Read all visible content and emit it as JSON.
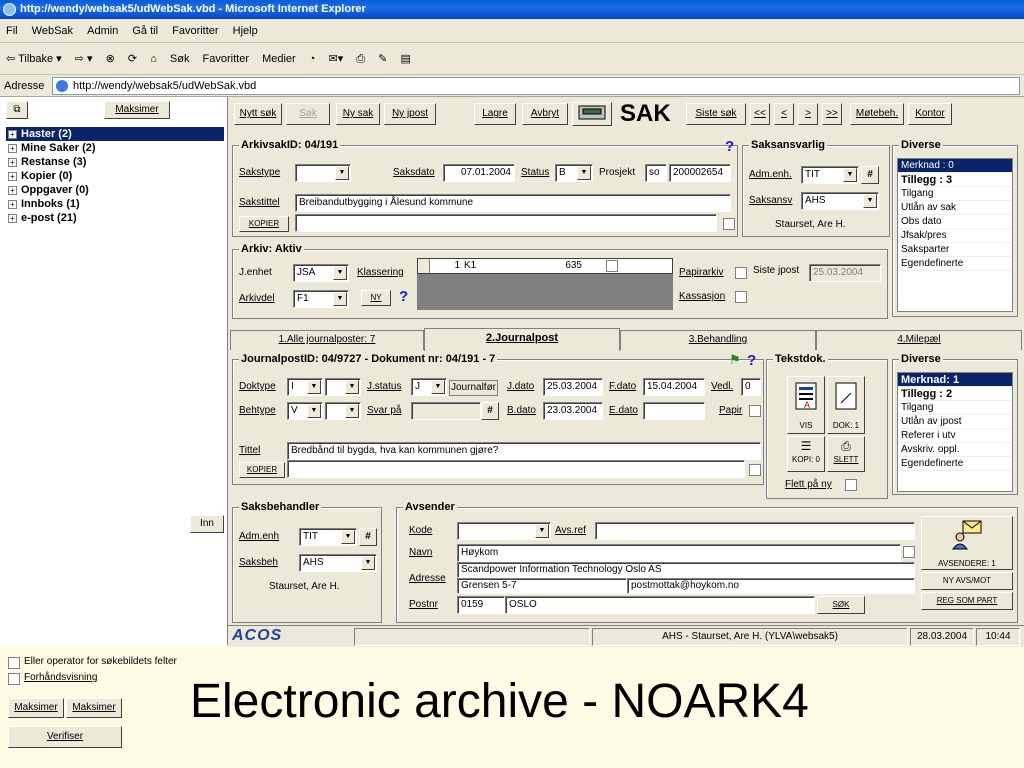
{
  "window": {
    "title": "http://wendy/websak5/udWebSak.vbd - Microsoft Internet Explorer"
  },
  "menu": [
    "Fil",
    "WebSak",
    "Admin",
    "Gå til",
    "Favoritter",
    "Hjelp"
  ],
  "browser_toolbar": [
    "⇦ Tilbake ▾",
    "⇨ ▾",
    "Søk",
    "Favoritter",
    "Medier"
  ],
  "address": {
    "label": "Adresse",
    "url": "http://wendy/websak5/udWebSak.vbd"
  },
  "left": {
    "maximize": "Maksimer",
    "tree": [
      "Haster (2)",
      "Mine Saker (2)",
      "Restanse (3)",
      "Kopier (0)",
      "Oppgaver (0)",
      "Innboks (1)",
      "e-post (21)"
    ],
    "inn": "Inn",
    "chk1": "Eller operator for søkebildets felter",
    "chk2": "Forhåndsvisning",
    "maks1": "Maksimer",
    "maks2": "Maksimer",
    "verify": "Verifiser"
  },
  "top_buttons": {
    "nytt_sok": "Nytt søk",
    "sok": "Søk",
    "ny_sak": "Ny sak",
    "ny_jpost": "Ny jpost",
    "lagre": "Lagre",
    "avbryt": "Avbryt",
    "sak": "SAK",
    "siste_sok": "Siste søk",
    "first": "<<",
    "prev": "<",
    "next": ">",
    "last": ">>",
    "motebeh": "Møtebeh.",
    "kontor": "Kontor"
  },
  "sak": {
    "legend": "ArkivsakID: 04/191",
    "sakstype_label": "Sakstype",
    "saksdato_label": "Saksdato",
    "saksdato": "07.01.2004",
    "status_label": "Status",
    "status": "B",
    "prosjekt_label": "Prosjekt",
    "prosjekt_code": "so",
    "prosjekt": "200002654",
    "sakstittel_label": "Sakstittel",
    "sakstittel": "Breibandutbygging i Ålesund kommune",
    "kopier": "KOPIER"
  },
  "saksansvarlig": {
    "legend": "Saksansvarlig",
    "adm_label": "Adm.enh.",
    "adm": "TIT",
    "hash": "#",
    "ansv_label": "Saksansv",
    "ansv": "AHS",
    "name": "Staurset, Are H."
  },
  "diverse_top": {
    "legend": "Diverse",
    "items": [
      "Merknad : 0",
      "Tillegg : 3",
      "Tilgang",
      "Utlån av sak",
      "Obs dato",
      "Jfsak/pres",
      "Saksparter",
      "Egendefinerte"
    ]
  },
  "arkiv": {
    "legend": "Arkiv: Aktiv",
    "jenhet_label": "J.enhet",
    "jenhet": "JSA",
    "klassering_label": "Klassering",
    "row_num": "1",
    "row_code": "K1",
    "row_val": "635",
    "arkivdel_label": "Arkivdel",
    "arkivdel": "F1",
    "ny": "NY",
    "papirarkiv": "Papirarkiv",
    "kassasjon": "Kassasjon",
    "siste_jpost_label": "Siste jpost",
    "siste_jpost": "25.03.2004"
  },
  "tabs": [
    "1.Alle journalposter: 7",
    "2.Journalpost",
    "3.Behandling",
    "4.Milepæl"
  ],
  "jpost": {
    "legend": "JournalpostID: 04/9727 - Dokument nr: 04/191 - 7",
    "doktype_label": "Doktype",
    "doktype": "I",
    "jstatus_label": "J.status",
    "jstatus": "J",
    "jstatus_text": "Journalfør",
    "jdato_label": "J.dato",
    "jdato": "25.03.2004",
    "fdato_label": "F.dato",
    "fdato": "15.04.2004",
    "vedl_label": "Vedl.",
    "vedl": "0",
    "behtype_label": "Behtype",
    "behtype": "V",
    "svar_label": "Svar på",
    "hash": "#",
    "bdato_label": "B.dato",
    "bdato": "23.03.2004",
    "edato_label": "E.dato",
    "papir_label": "Papir",
    "tittel_label": "Tittel",
    "tittel": "Bredbånd til bygda, hva kan kommunen gjøre?",
    "kopier": "KOPIER"
  },
  "tekstdok": {
    "legend": "Tekstdok.",
    "vis": "VIS",
    "dok": "DOK: 1",
    "kopi": "KOPI: 0",
    "slett": "SLETT",
    "flett": "Flett på ny"
  },
  "diverse_mid": {
    "legend": "Diverse",
    "items": [
      "Merknad: 1",
      "Tillegg : 2",
      "Tilgang",
      "Utlån av jpost",
      "Referer i utv",
      "Avskriv. oppl.",
      "Egendefinerte"
    ]
  },
  "saksbehandler": {
    "legend": "Saksbehandler",
    "adm_label": "Adm.enh",
    "adm": "TIT",
    "hash": "#",
    "beh_label": "Saksbeh",
    "beh": "AHS",
    "name": "Staurset, Are H."
  },
  "avsender": {
    "legend": "Avsender",
    "kode_label": "Kode",
    "avsref_label": "Avs.ref",
    "navn_label": "Navn",
    "navn": "Høykom",
    "adresse_label": "Adresse",
    "adresse1": "Scandpower Information Technology Oslo AS",
    "adresse2": "Grensen 5-7",
    "email": "postmottak@hoykom.no",
    "postnr_label": "Postnr",
    "postnr": "0159",
    "poststed": "OSLO",
    "sok": "SØK",
    "avsendere": "AVSENDERE: 1",
    "ny_avs": "NY AVS/MOT",
    "reg_som_part": "REG SOM PART"
  },
  "status": {
    "logo": "ACOS",
    "user": "AHS - Staurset, Are H.   (YLVA\\websak5)",
    "date": "28.03.2004",
    "time": "10:44"
  },
  "slide_title": "Electronic archive - NOARK4"
}
